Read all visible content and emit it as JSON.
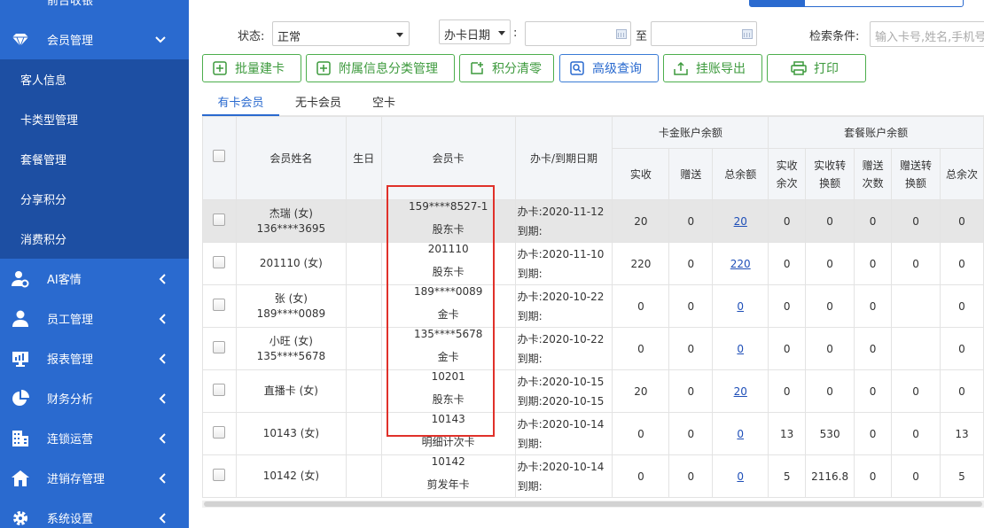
{
  "sidebar": {
    "top_label": "前台收银",
    "active_menu": "会员管理",
    "submenu": [
      "客人信息",
      "卡类型管理",
      "套餐管理",
      "分享积分",
      "消费积分"
    ],
    "menus": [
      "AI客情",
      "员工管理",
      "报表管理",
      "财务分析",
      "连锁运营",
      "进销存管理",
      "系统设置"
    ],
    "colors": {
      "bg": "#2a6acf",
      "submenu_bg": "#1d4fa3"
    }
  },
  "filters": {
    "status_label": "状态:",
    "status_value": "正常",
    "date_type_value": "办卡日期",
    "colon": ":",
    "to_label": "至",
    "search_label": "检索条件:",
    "search_placeholder": "输入卡号,姓名,手机号"
  },
  "actions": [
    "批量建卡",
    "附属信息分类管理",
    "积分清零",
    "高级查询",
    "挂账导出",
    "打印"
  ],
  "tabs": [
    "有卡会员",
    "无卡会员",
    "空卡"
  ],
  "table": {
    "headers": {
      "name": "会员姓名",
      "birthday": "生日",
      "card": "会员卡",
      "dates": "办卡/到期日期",
      "cash_group": "卡金账户余额",
      "cash_cols": [
        "实收",
        "赠送",
        "总余额"
      ],
      "pkg_group": "套餐账户余额",
      "pkg_cols": [
        "实收余次",
        "实收转换额",
        "赠送次数",
        "赠送转换额",
        "总余次"
      ]
    },
    "open_prefix": "办卡:",
    "expire_prefix": "到期:",
    "rows": [
      {
        "name": "杰瑞 (女)",
        "phone": "136****3695",
        "card_no": "159****8527-1",
        "card_type": "股东卡",
        "open_date": "2020-11-12",
        "expire": "",
        "paid": "20",
        "gift": "0",
        "total": "20",
        "p_paid": "0",
        "p_amt": "0",
        "p_gift": "0",
        "p_gift_amt": "0",
        "p_total": "0"
      },
      {
        "name": "201110 (女)",
        "phone": "",
        "card_no": "201110",
        "card_type": "股东卡",
        "open_date": "2020-11-10",
        "expire": "",
        "paid": "220",
        "gift": "0",
        "total": "220",
        "p_paid": "0",
        "p_amt": "0",
        "p_gift": "0",
        "p_gift_amt": "0",
        "p_total": "0"
      },
      {
        "name": "张 (女)",
        "phone": "189****0089",
        "card_no": "189****0089",
        "card_type": "金卡",
        "open_date": "2020-10-22",
        "expire": "",
        "paid": "0",
        "gift": "0",
        "total": "0",
        "p_paid": "0",
        "p_amt": "0",
        "p_gift": "0",
        "p_gift_amt": "",
        "p_total": "0"
      },
      {
        "name": "小旺 (女)",
        "phone": "135****5678",
        "card_no": "135****5678",
        "card_type": "金卡",
        "open_date": "2020-10-22",
        "expire": "",
        "paid": "0",
        "gift": "0",
        "total": "0",
        "p_paid": "0",
        "p_amt": "0",
        "p_gift": "0",
        "p_gift_amt": "",
        "p_total": "0"
      },
      {
        "name": "直播卡 (女)",
        "phone": "",
        "card_no": "10201",
        "card_type": "股东卡",
        "open_date": "2020-10-15",
        "expire": "2020-10-15",
        "paid": "20",
        "gift": "0",
        "total": "20",
        "p_paid": "0",
        "p_amt": "0",
        "p_gift": "0",
        "p_gift_amt": "0",
        "p_total": "0"
      },
      {
        "name": "10143 (女)",
        "phone": "",
        "card_no": "10143",
        "card_type": "明细计次卡",
        "open_date": "2020-10-14",
        "expire": "",
        "paid": "0",
        "gift": "0",
        "total": "0",
        "p_paid": "13",
        "p_amt": "530",
        "p_gift": "0",
        "p_gift_amt": "0",
        "p_total": "13"
      },
      {
        "name": "10142 (女)",
        "phone": "",
        "card_no": "10142",
        "card_type": "剪发年卡",
        "open_date": "2020-10-14",
        "expire": "",
        "paid": "0",
        "gift": "0",
        "total": "0",
        "p_paid": "5",
        "p_amt": "2116.8",
        "p_gift": "0",
        "p_gift_amt": "0",
        "p_total": "5"
      }
    ]
  }
}
